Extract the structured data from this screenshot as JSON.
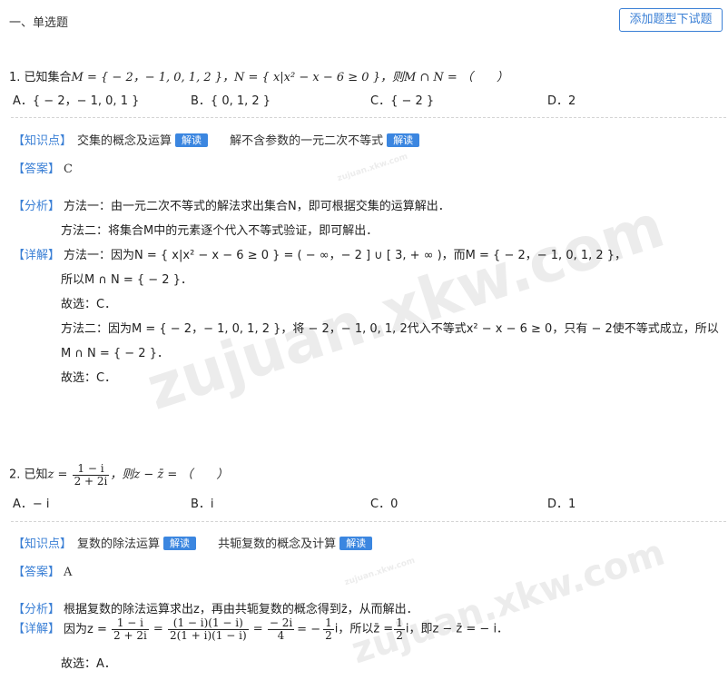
{
  "section": {
    "title": "一、单选题",
    "add_button": "添加题型下试题"
  },
  "q1": {
    "stem_prefix": "1. 已知集合",
    "stem_rest": "M = { − 2，− 1, 0, 1, 2 }，N = { x|x² − x − 6 ≥ 0 }，则M ∩ N = （　　）",
    "options": [
      "A．{ − 2，− 1, 0, 1 }",
      "B．{ 0, 1, 2 }",
      "C．{ − 2 }",
      "D．2"
    ],
    "tag_kp": "【知识点】",
    "kp1": "交集的概念及运算",
    "kp2": "解不含参数的一元二次不等式",
    "badge": "解读",
    "tag_answer": "【答案】",
    "answer": "C",
    "tag_analysis": "【分析】",
    "analysis1": "方法一：由一元二次不等式的解法求出集合N，即可根据交集的运算解出．",
    "analysis2": "方法二：将集合M中的元素逐个代入不等式验证，即可解出．",
    "tag_detail": "【详解】",
    "detail1": "方法一：因为N = { x|x² − x − 6 ≥ 0 } = ( − ∞，− 2 ] ∪ [ 3, + ∞ )，而M = { − 2，− 1, 0, 1, 2 }，",
    "detail2": "所以M ∩ N = { − 2 }．",
    "detail3": "故选：C．",
    "detail4": "方法二：因为M = { − 2，− 1, 0, 1, 2 }，将 − 2，− 1, 0, 1, 2代入不等式x² − x − 6 ≥ 0，只有 − 2使不等式成立，所以",
    "detail5": "M ∩ N = { − 2 }．",
    "detail6": "故选：C．"
  },
  "q2": {
    "stem_prefix": "2. 已知",
    "stem_z": "z = ",
    "frac_num": "1 − i",
    "frac_den": "2 + 2i",
    "stem_rest": "，则z − z̄ = （　　）",
    "options": [
      "A．− i",
      "B．i",
      "C．0",
      "D．1"
    ],
    "tag_kp": "【知识点】",
    "kp1": "复数的除法运算",
    "kp2": "共轭复数的概念及计算",
    "badge": "解读",
    "tag_answer": "【答案】",
    "answer": "A",
    "tag_analysis": "【分析】",
    "analysis1": "根据复数的除法运算求出z，再由共轭复数的概念得到z̄，从而解出．",
    "tag_detail": "【详解】",
    "detail_prefix": "因为z = ",
    "f1n": "1 − i",
    "f1d": "2 + 2i",
    "f2n": "(1 − i)(1 − i)",
    "f2d": "2(1 + i)(1 − i)",
    "f3n": "− 2i",
    "f3d": "4",
    "eq_minus": "= −",
    "f4n": "1",
    "f4d": "2",
    "mid1": "i，所以z̄ =",
    "f5n": "1",
    "f5d": "2",
    "mid2": "i，即z − z̄ = − i．",
    "detail_last": "故选：A．"
  },
  "watermark": {
    "main": "zujuan.xkw.com",
    "small": "zujuan.xkw.com"
  }
}
